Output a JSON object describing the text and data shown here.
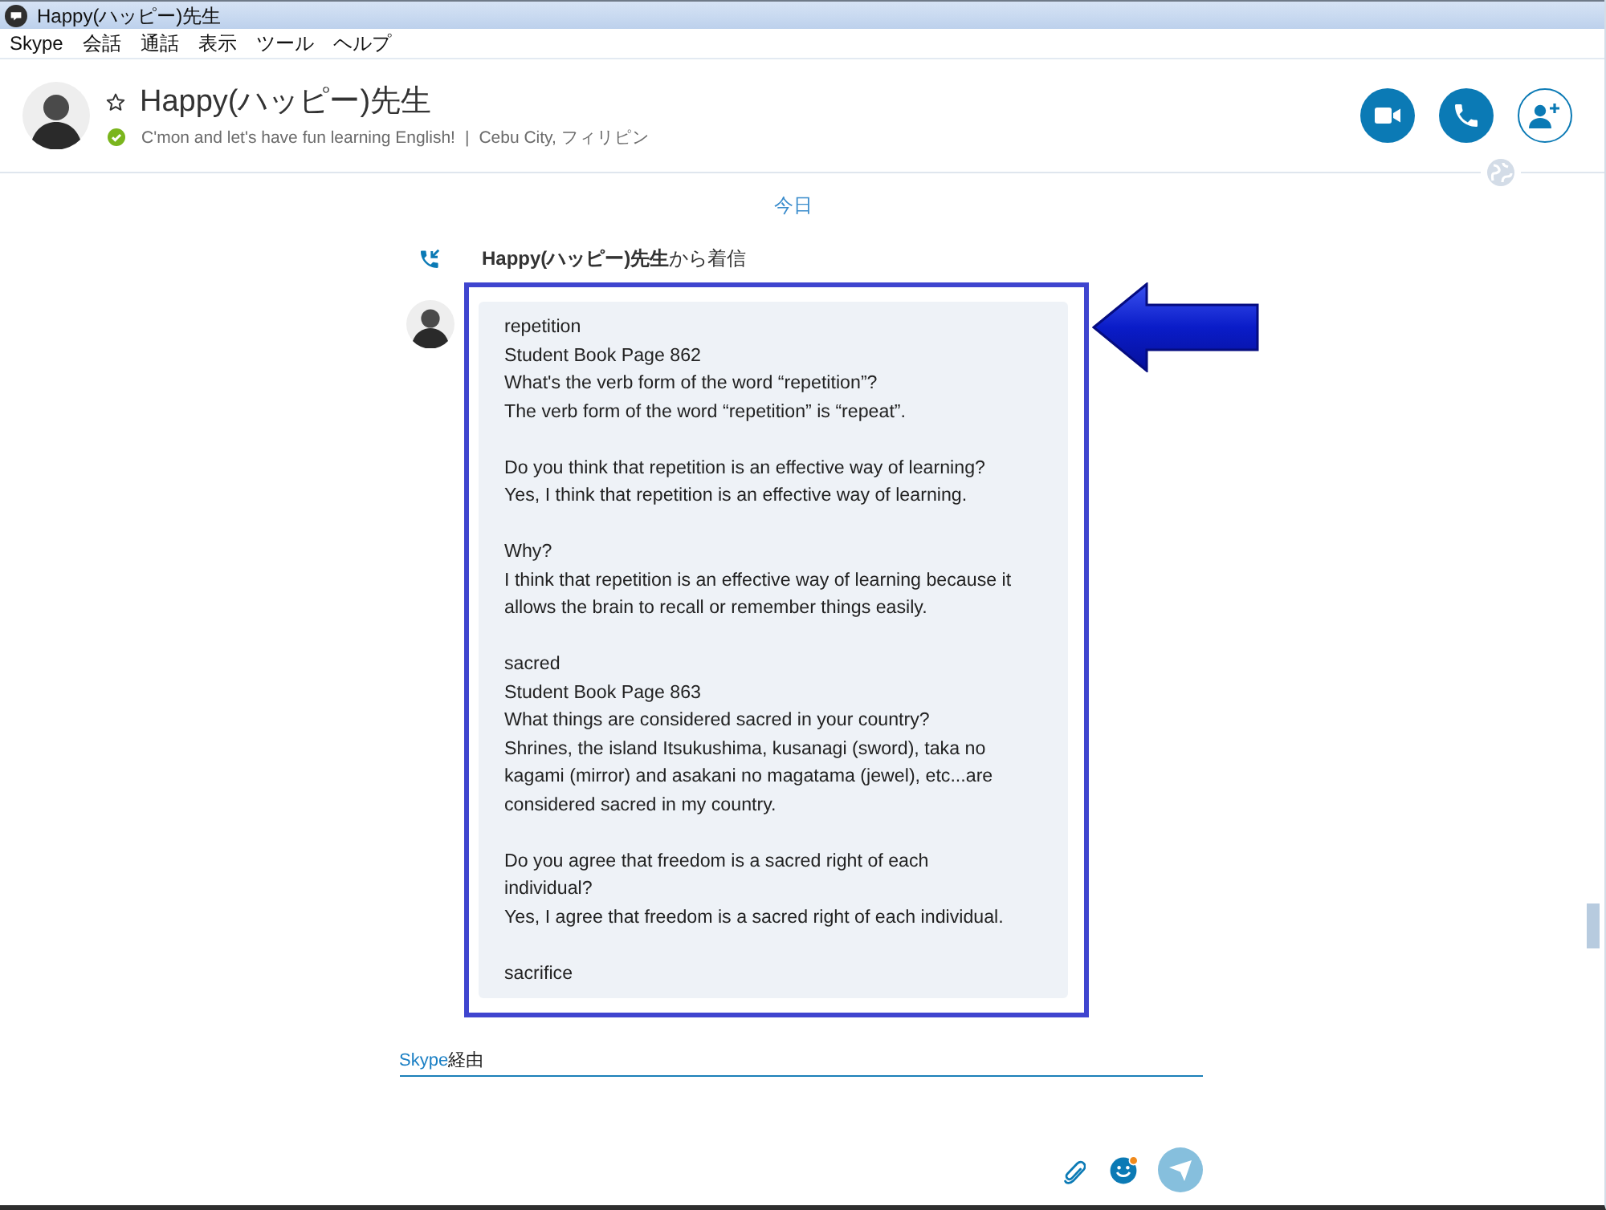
{
  "window": {
    "title": "Happy(ハッピー)先生"
  },
  "menu": [
    {
      "label": "Skype"
    },
    {
      "label": "会話"
    },
    {
      "label": "通話"
    },
    {
      "label": "表示"
    },
    {
      "label": "ツール"
    },
    {
      "label": "ヘルプ"
    }
  ],
  "contact": {
    "name": "Happy(ハッピー)先生",
    "favorite": false,
    "online": true,
    "mood": "C'mon and let's have fun learning English!",
    "separator": "|",
    "location": "Cebu City, フィリピン"
  },
  "chat": {
    "day": "今日",
    "call_notice": "**Happy(ハッピー)先生**から着信",
    "message": {
      "paragraphs": [
        [
          "repetition",
          "Student Book Page 862",
          "What's the verb form of the word “repetition”?",
          "The verb form of the word “repetition” is “repeat”."
        ],
        [
          "Do you think that repetition is an effective way of learning?",
          "Yes, I think that repetition is an effective way of learning."
        ],
        [
          "Why?",
          "I think that repetition is an effective way of learning because it allows the brain to recall or remember things easily."
        ],
        [
          "sacred",
          "Student Book Page 863",
          "What things are considered sacred in your country?",
          "Shrines, the island Itsukushima, kusanagi (sword), taka no kagami (mirror) and asakani no magatama (jewel), etc...are considered sacred in my country."
        ],
        [
          "Do you agree that freedom is a sacred right of each individual?",
          "Yes, I agree that freedom is a sacred right of each individual."
        ],
        [
          "sacrifice"
        ]
      ]
    }
  },
  "composer": {
    "via_link": "Skype",
    "via_suffix": "経由"
  }
}
